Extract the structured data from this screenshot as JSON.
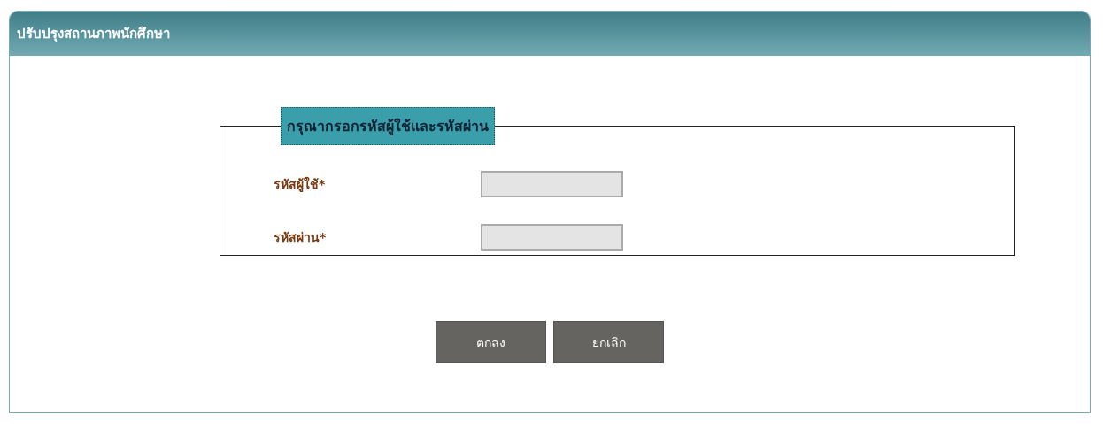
{
  "panel": {
    "title": "ปรับปรุงสถานภาพนักศึกษา"
  },
  "form": {
    "legend": "กรุณากรอกรหัสผู้ใช้และรหัสผ่าน",
    "fields": [
      {
        "label": "รหัสผู้ใช้*"
      },
      {
        "label": "รหัสผ่าน*"
      }
    ]
  },
  "buttons": [
    "ตกลง",
    "ยกเลิก"
  ]
}
